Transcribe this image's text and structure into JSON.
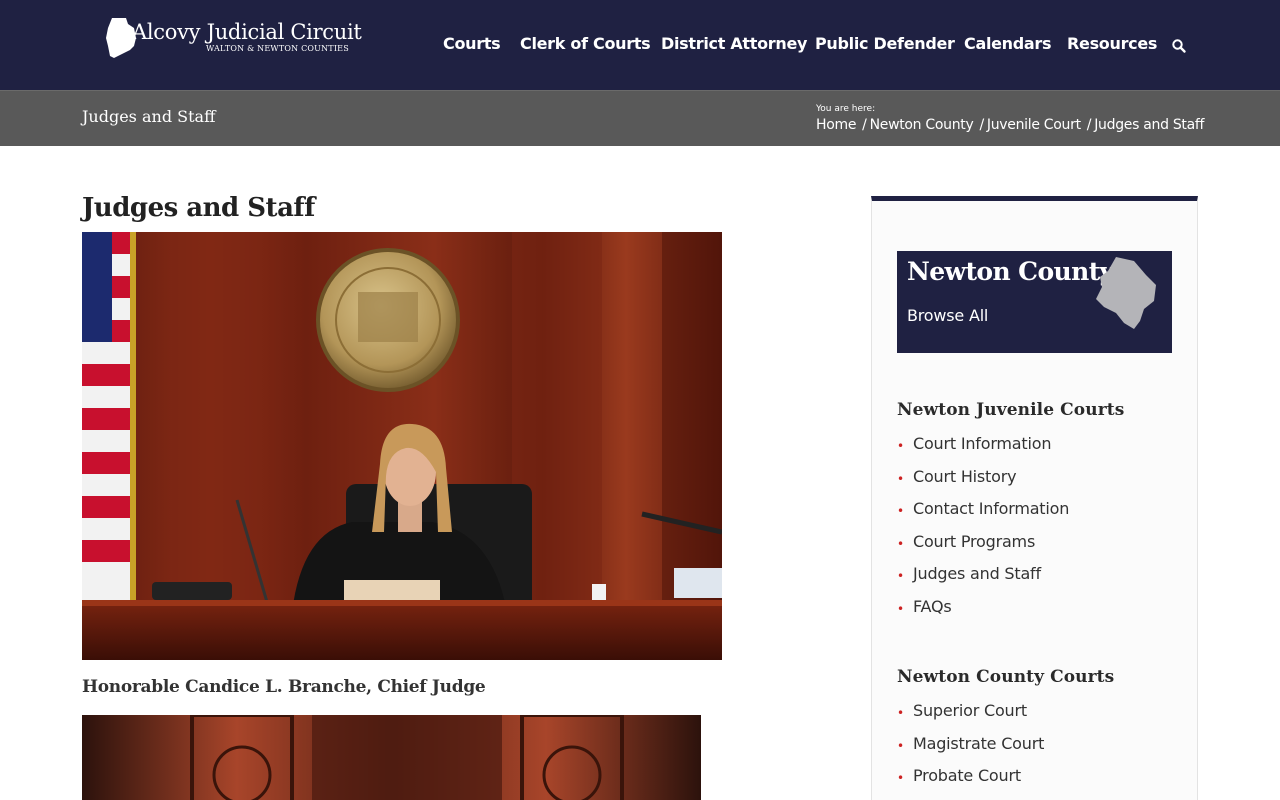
{
  "header": {
    "logo_title": "Alcovy Judicial Circuit",
    "logo_subtitle": "WALTON & NEWTON COUNTIES",
    "nav": [
      "Courts",
      "Clerk of Courts",
      "District Attorney",
      "Public Defender",
      "Calendars",
      "Resources"
    ],
    "search_icon": "search-icon",
    "background": "#1f2142"
  },
  "titlebar": {
    "title": "Judges and Staff",
    "you_are_here": "You are here:",
    "breadcrumbs": [
      "Home",
      "Newton County",
      "Juvenile Court",
      "Judges and Staff"
    ],
    "separator": "/"
  },
  "main": {
    "heading": "Judges and Staff",
    "photo1_alt": "Judge seated at courtroom bench with State of Georgia seal",
    "caption1": "Honorable Candice L. Branche, Chief Judge",
    "photo2_alt": "Courtroom bench"
  },
  "sidebar": {
    "county_title": "Newton County",
    "county_browse": "Browse All",
    "juvenile_heading": "Newton Juvenile Courts",
    "juvenile_links": [
      "Court Information",
      "Court History",
      "Contact Information",
      "Court Programs",
      "Judges and Staff",
      "FAQs"
    ],
    "county_heading": "Newton County Courts",
    "county_links": [
      "Superior Court",
      "Magistrate Court",
      "Probate Court"
    ],
    "bullet_color": "#cc2222"
  }
}
